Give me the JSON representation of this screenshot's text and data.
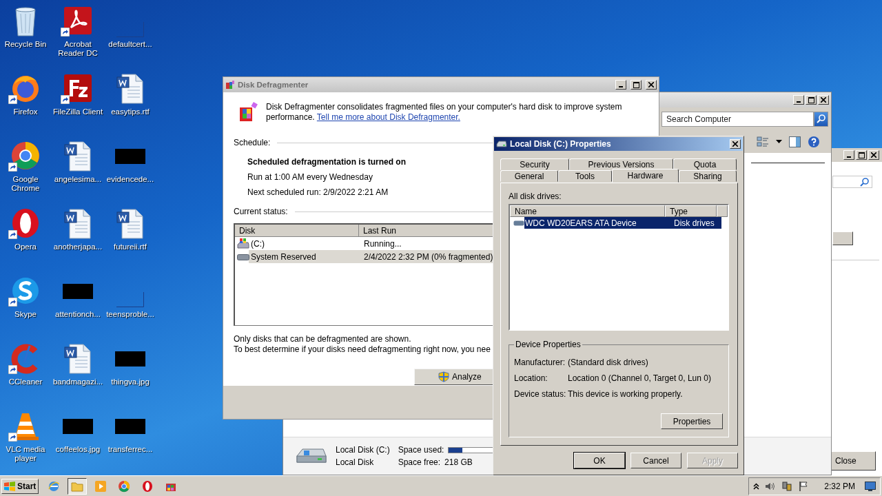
{
  "desktop_icons": [
    {
      "label": "Recycle Bin",
      "kind": "recycle",
      "shortcut": false
    },
    {
      "label": "Acrobat Reader DC",
      "kind": "pdf",
      "shortcut": true
    },
    {
      "label": "defaultcert...",
      "kind": "blank",
      "shortcut": false
    },
    {
      "label": "Firefox",
      "kind": "globe",
      "shortcut": true
    },
    {
      "label": "FileZilla Client",
      "kind": "ftp",
      "shortcut": true
    },
    {
      "label": "easytips.rtf",
      "kind": "document",
      "shortcut": false
    },
    {
      "label": "Google Chrome",
      "kind": "wheel",
      "shortcut": true
    },
    {
      "label": "angelesima...",
      "kind": "document",
      "shortcut": false
    },
    {
      "label": "evidencede...",
      "kind": "redacted",
      "shortcut": false
    },
    {
      "label": "Opera",
      "kind": "ring",
      "shortcut": true
    },
    {
      "label": "anotherjapa...",
      "kind": "document",
      "shortcut": false
    },
    {
      "label": "futureii.rtf",
      "kind": "document",
      "shortcut": false
    },
    {
      "label": "Skype",
      "kind": "cloud",
      "shortcut": true
    },
    {
      "label": "attentionch...",
      "kind": "redacted",
      "shortcut": false
    },
    {
      "label": "teensproble...",
      "kind": "blank",
      "shortcut": false
    },
    {
      "label": "CCleaner",
      "kind": "brush",
      "shortcut": true
    },
    {
      "label": "bandmagazi...",
      "kind": "document",
      "shortcut": false
    },
    {
      "label": "thingva.jpg",
      "kind": "redacted",
      "shortcut": false
    },
    {
      "label": "VLC media player",
      "kind": "cone",
      "shortcut": true
    },
    {
      "label": "coffeelos.jpg",
      "kind": "redacted",
      "shortcut": false
    },
    {
      "label": "transferrec...",
      "kind": "redacted",
      "shortcut": false
    }
  ],
  "explorer": {
    "search_placeholder": "Search Computer",
    "drive_name": "Local Disk (C:)",
    "drive_type": "Local Disk",
    "space_used_label": "Space used:",
    "level": 0.14,
    "space_free_label": "Space free:",
    "space_free": "218 GB"
  },
  "back_window": {
    "close_button": "Close"
  },
  "defragmenter": {
    "title": "Disk Defragmenter",
    "description": "Disk Defragmenter consolidates fragmented files on your computer's hard disk to improve system performance.",
    "link": "Tell me more about Disk Defragmenter.",
    "schedule_label": "Schedule:",
    "schedule_status": "Scheduled defragmentation is turned on",
    "schedule_time": "Run at 1:00 AM every Wednesday",
    "next_run": "Next scheduled run: 2/9/2022 2:21 AM",
    "status_label": "Current status:",
    "columns": [
      "Disk",
      "Last Run"
    ],
    "rows": [
      {
        "disk": "(C:)",
        "last_run": "Running...",
        "kind": "system",
        "selected": false
      },
      {
        "disk": "System Reserved",
        "last_run": "2/4/2022 2:32 PM (0% fragmented)",
        "kind": "drive",
        "selected": true
      }
    ],
    "notes": [
      "Only disks that can be defragmented are shown.",
      "To best determine if your disks need defragmenting right now, you nee"
    ],
    "analyze_button": "Analyze"
  },
  "properties": {
    "title": "Local Disk (C:) Properties",
    "tab_rows": [
      [
        {
          "label": "Security",
          "selected": false
        },
        {
          "label": "Previous Versions",
          "selected": false
        },
        {
          "label": "Quota",
          "selected": false
        }
      ],
      [
        {
          "label": "General",
          "selected": false
        },
        {
          "label": "Tools",
          "selected": false
        },
        {
          "label": "Hardware",
          "selected": true
        },
        {
          "label": "Sharing",
          "selected": false
        }
      ]
    ],
    "list_label": "All disk drives:",
    "columns": [
      "Name",
      "Type"
    ],
    "rows": [
      {
        "name": "WDC WD20EARS ATA Device",
        "type": "Disk drives",
        "selected": true
      }
    ],
    "group_title": "Device Properties",
    "fields": [
      {
        "label": "Manufacturer:",
        "value": "(Standard disk drives)"
      },
      {
        "label": "Location:",
        "value": "Location 0 (Channel 0, Target 0, Lun 0)"
      },
      {
        "label": "Device status:",
        "value": "This device is working properly."
      }
    ],
    "properties_button": "Properties",
    "buttons": [
      {
        "label": "OK",
        "default": true,
        "disabled": false
      },
      {
        "label": "Cancel",
        "default": false,
        "disabled": false
      },
      {
        "label": "Apply",
        "default": false,
        "disabled": true
      }
    ]
  },
  "taskbar": {
    "start": "Start",
    "items": [
      {
        "kind": "browser",
        "selected": false
      },
      {
        "kind": "folder",
        "selected": true
      },
      {
        "kind": "media",
        "selected": false
      },
      {
        "kind": "wheel",
        "selected": false
      },
      {
        "kind": "ring",
        "selected": false
      },
      {
        "kind": "defrag",
        "selected": false
      }
    ],
    "clock": "2:32 PM"
  }
}
